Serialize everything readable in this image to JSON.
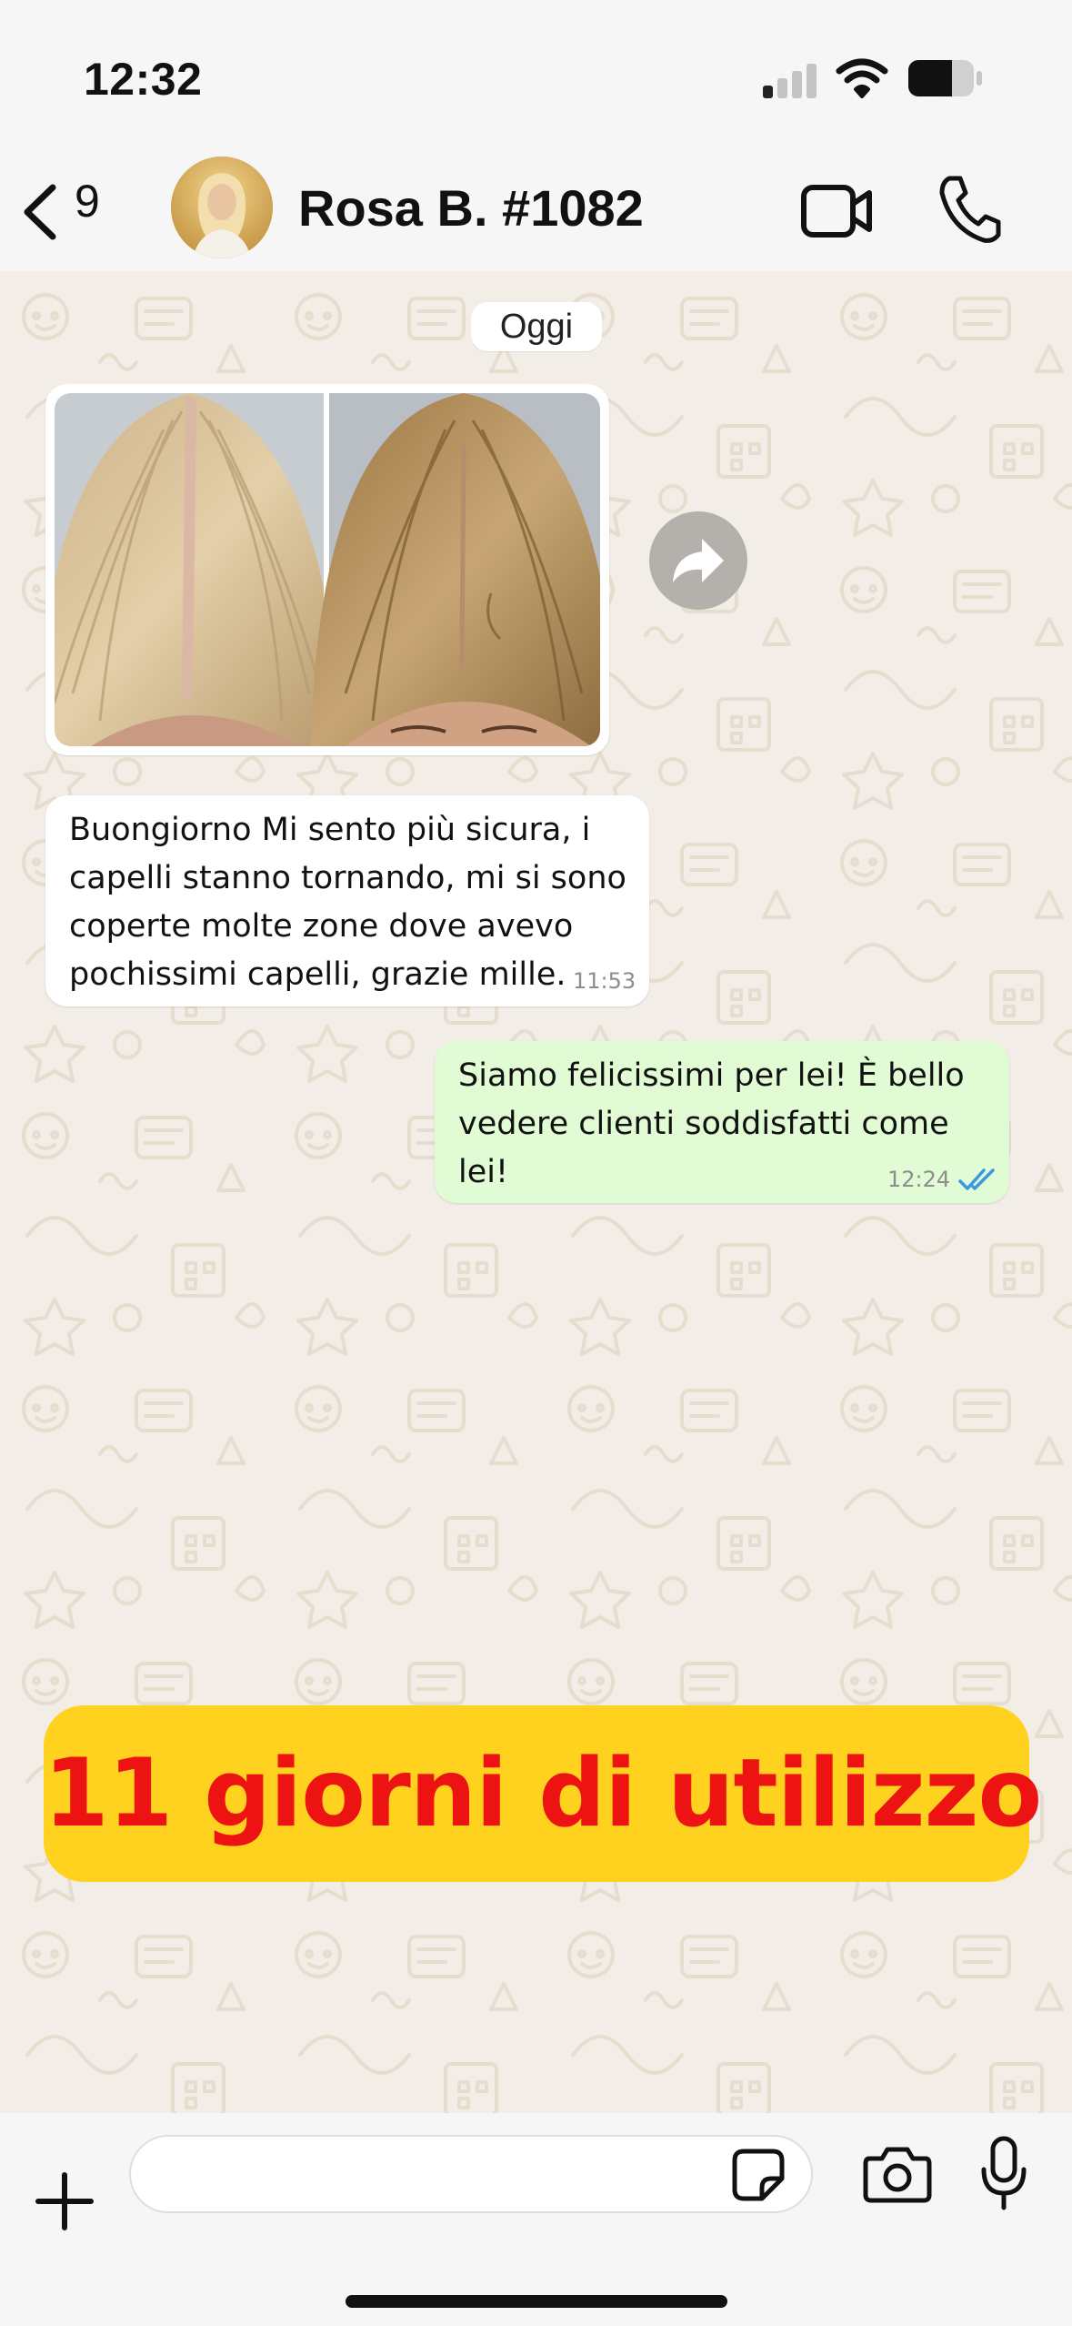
{
  "status_bar": {
    "time": "12:32",
    "icons": [
      "cellular-signal-icon",
      "wifi-icon",
      "battery-icon"
    ]
  },
  "header": {
    "back_count": "9",
    "contact_name": "Rosa B. #1082",
    "icons": [
      "chevron-left-icon",
      "video-camera-icon",
      "phone-icon"
    ]
  },
  "chat": {
    "date_chip": "Oggi",
    "image_message": {
      "description_icons": [
        "forward-icon"
      ]
    },
    "incoming_message": {
      "lines": [
        "Buongiorno Mi sento più sicura, i",
        "capelli stanno tornando, mi si sono",
        "coperte molte zone dove avevo",
        "pochissimi capelli, grazie mille."
      ],
      "time": "11:53"
    },
    "outgoing_message": {
      "lines": [
        "Siamo felicissimi per lei! È bello",
        "vedere clienti soddisfatti come",
        "lei!"
      ],
      "time": "12:24",
      "status": "read"
    },
    "promo_banner": "11 giorni di utilizzo"
  },
  "input_bar": {
    "placeholder": "",
    "icons": [
      "plus-icon",
      "sticker-icon",
      "camera-icon",
      "microphone-icon"
    ]
  },
  "colors": {
    "chat_background": "#f2eee7",
    "incoming_bubble": "#ffffff",
    "outgoing_bubble": "#e1fbd4",
    "read_receipt": "#3b96e6",
    "promo_background": "#ffd21f",
    "promo_text": "#ee1313"
  }
}
